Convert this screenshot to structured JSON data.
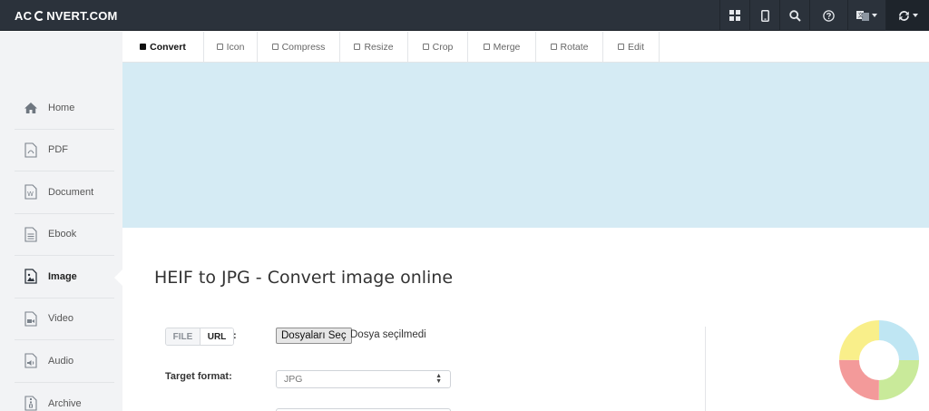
{
  "app": {
    "logo_left": "AC",
    "logo_right": "NVERT.COM"
  },
  "navbar": {
    "icons": [
      "grid-icon",
      "mobile-icon",
      "search-icon",
      "help-icon",
      "language-icon",
      "refresh-icon"
    ]
  },
  "tabs": [
    {
      "label": "Convert",
      "active": true
    },
    {
      "label": "Icon",
      "active": false
    },
    {
      "label": "Compress",
      "active": false
    },
    {
      "label": "Resize",
      "active": false
    },
    {
      "label": "Crop",
      "active": false
    },
    {
      "label": "Merge",
      "active": false
    },
    {
      "label": "Rotate",
      "active": false
    },
    {
      "label": "Edit",
      "active": false
    }
  ],
  "sidebar": {
    "items": [
      {
        "label": "Home",
        "icon": "home-icon"
      },
      {
        "label": "PDF",
        "icon": "pdf-file-icon"
      },
      {
        "label": "Document",
        "icon": "word-file-icon"
      },
      {
        "label": "Ebook",
        "icon": "ebook-file-icon"
      },
      {
        "label": "Image",
        "icon": "image-file-icon",
        "active": true
      },
      {
        "label": "Video",
        "icon": "video-file-icon"
      },
      {
        "label": "Audio",
        "icon": "audio-file-icon"
      },
      {
        "label": "Archive",
        "icon": "archive-file-icon"
      }
    ]
  },
  "main": {
    "title": "HEIF to JPG - Convert image online",
    "source_toggle": {
      "file": "FILE",
      "url": "URL",
      "colon": ":"
    },
    "file_button": "Dosyaları Seç",
    "file_status": "Dosya seçilmedi",
    "target_label": "Target format:",
    "target_value": "JPG"
  },
  "colors": {
    "navbar": "#2b323b",
    "sidebar": "#f2f3f5",
    "banner": "#d5ebf4",
    "donut": [
      "#bfe6f3",
      "#c9ea9a",
      "#f39a9a",
      "#f9ef8a"
    ]
  }
}
